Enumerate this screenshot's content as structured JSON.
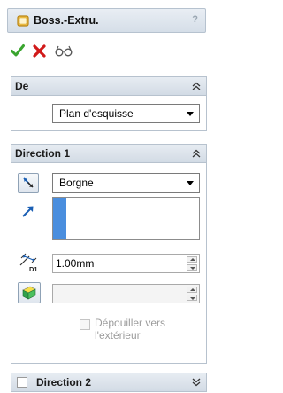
{
  "header": {
    "title": "Boss.-Extru.",
    "help": "?"
  },
  "actions": {
    "ok": "ok-check",
    "cancel": "cancel-x",
    "preview": "preview-glasses"
  },
  "section_from": {
    "title": "De",
    "dropdown_value": "Plan d'esquisse"
  },
  "section_direction1": {
    "title": "Direction 1",
    "end_condition": "Borgne",
    "depth_value": "1.00mm",
    "draft_value": "",
    "draft_outward_label_line1": "Dépouiller vers",
    "draft_outward_label_line2": "l'extérieur"
  },
  "section_direction2": {
    "title": "Direction 2"
  },
  "colors": {
    "accent_blue": "#4a8ede",
    "header_bg": "#d9e1ea",
    "ok_green": "#3aa52f",
    "cancel_red": "#d11a1a"
  }
}
